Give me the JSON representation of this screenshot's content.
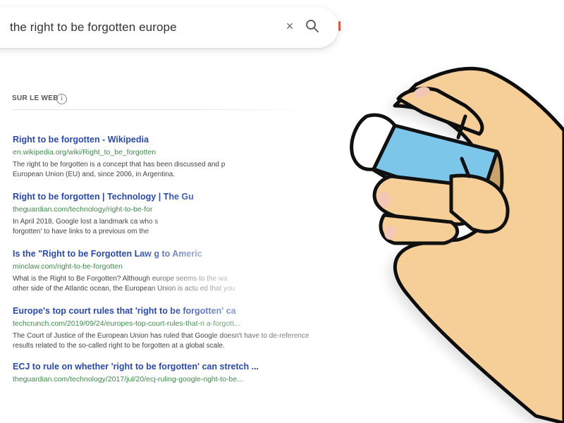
{
  "search": {
    "query": "the right to be forgotten europe",
    "clear_icon": "close-icon",
    "search_icon": "search-icon"
  },
  "section": {
    "header": "SUR LE WEB",
    "info_glyph": "i"
  },
  "results": [
    {
      "title": "Right to be forgotten - Wikipedia",
      "url": "en.wikipedia.org/wiki/Right_to_be_forgotten",
      "snippet_lines": [
        "The right to be forgotten is a concept that has been discussed and p",
        "European Union (EU) and, since 2006, in Argentina."
      ]
    },
    {
      "title": "Right to be forgotten | Technology | The Gu",
      "url": "theguardian.com/technology/right-to-be-for",
      "snippet_lines": [
        "In April 2018, Google lost a landmark ca                              who s",
        "forgotten' to have links to a previous                          om the"
      ]
    },
    {
      "title": "Is the \"Right to be Forgotten Law                     g to Americ",
      "url": "minclaw.com/right-to-be-forgotten",
      "snippet_lines": [
        "What is the Right to Be Forgotten? Although europe seems to                    the wa",
        "other side of the Atlantic ocean, the European Union is actu                        ed that you"
      ]
    },
    {
      "title": "Europe's top court rules that 'right to be forgotten' ca",
      "url": "techcrunch.com/2019/09/24/europes-top-court-rules-that-ri          a-forgott...",
      "snippet_lines": [
        "The Court of Justice of the European Union has ruled that Google doesn't have to de-reference",
        "results related to the so-called right to be forgotten at a global scale."
      ]
    },
    {
      "title": "ECJ to rule on whether 'right to be forgotten' can stretch ...",
      "url": "theguardian.com/technology/2017/jul/20/ecj-ruling-google-right-to-be...",
      "snippet_lines": []
    }
  ],
  "colors": {
    "link": "#2a4aa6",
    "url": "#3d8a4a",
    "skin": "#f6cf98",
    "eraser_blue": "#7cc6ea",
    "eraser_dark_blue": "#4c8fdc"
  },
  "illustration": "hand-holding-eraser-icon"
}
